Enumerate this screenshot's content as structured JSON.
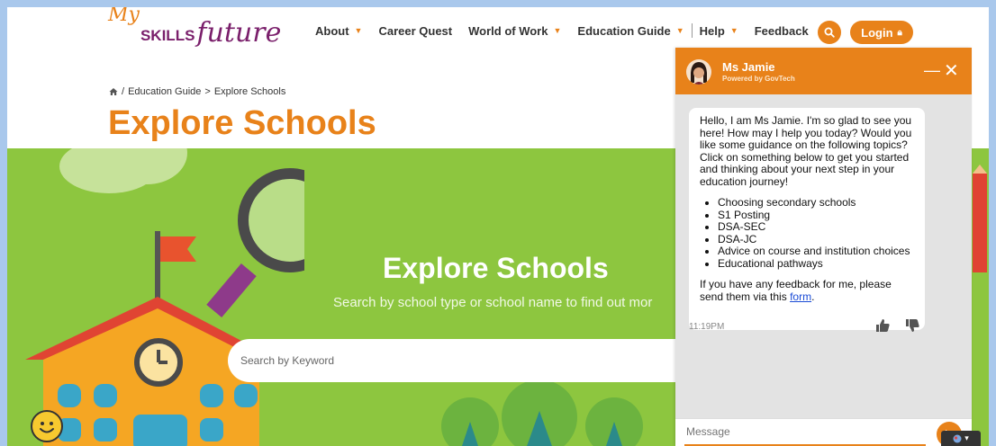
{
  "header": {
    "logo_my": "My",
    "logo_skills": "SKILLS",
    "logo_future": "future",
    "nav": [
      {
        "label": "About",
        "has_caret": true
      },
      {
        "label": "Career Quest",
        "has_caret": false
      },
      {
        "label": "World of Work",
        "has_caret": true
      },
      {
        "label": "Education Guide",
        "has_caret": true
      },
      {
        "label": "Help",
        "has_caret": true
      },
      {
        "label": "Feedback",
        "has_caret": false
      }
    ],
    "search_icon": "search-icon",
    "login_label": "Login",
    "accent_color": "#e8821a"
  },
  "breadcrumb": {
    "home_icon": "home-icon",
    "separator": "/",
    "items": [
      "Education Guide",
      ">",
      "Explore Schools"
    ]
  },
  "page_title": "Explore Schools",
  "hero": {
    "title": "Explore Schools",
    "subtitle": "Search by school type or school name to find out mor",
    "search_placeholder": "Search by Keyword",
    "bg_color": "#8dc63f"
  },
  "chat": {
    "name": "Ms Jamie",
    "powered_by": "Powered by GovTech",
    "minimize_label": "—",
    "close_label": "✕",
    "message_intro": "Hello, I am Ms Jamie. I'm so glad to see you here! How may I help you today? Would you like some guidance on the following topics? Click on something below to get you started and thinking about your next step in your education journey!",
    "topics": [
      "Choosing secondary schools",
      "S1 Posting",
      "DSA-SEC",
      "DSA-JC",
      "Advice on course and institution choices",
      "Educational pathways"
    ],
    "feedback_text": "If you have any feedback for me, please send them via this ",
    "feedback_link": "form",
    "feedback_end": ".",
    "time": "11:19PM",
    "input_placeholder": "Message"
  }
}
